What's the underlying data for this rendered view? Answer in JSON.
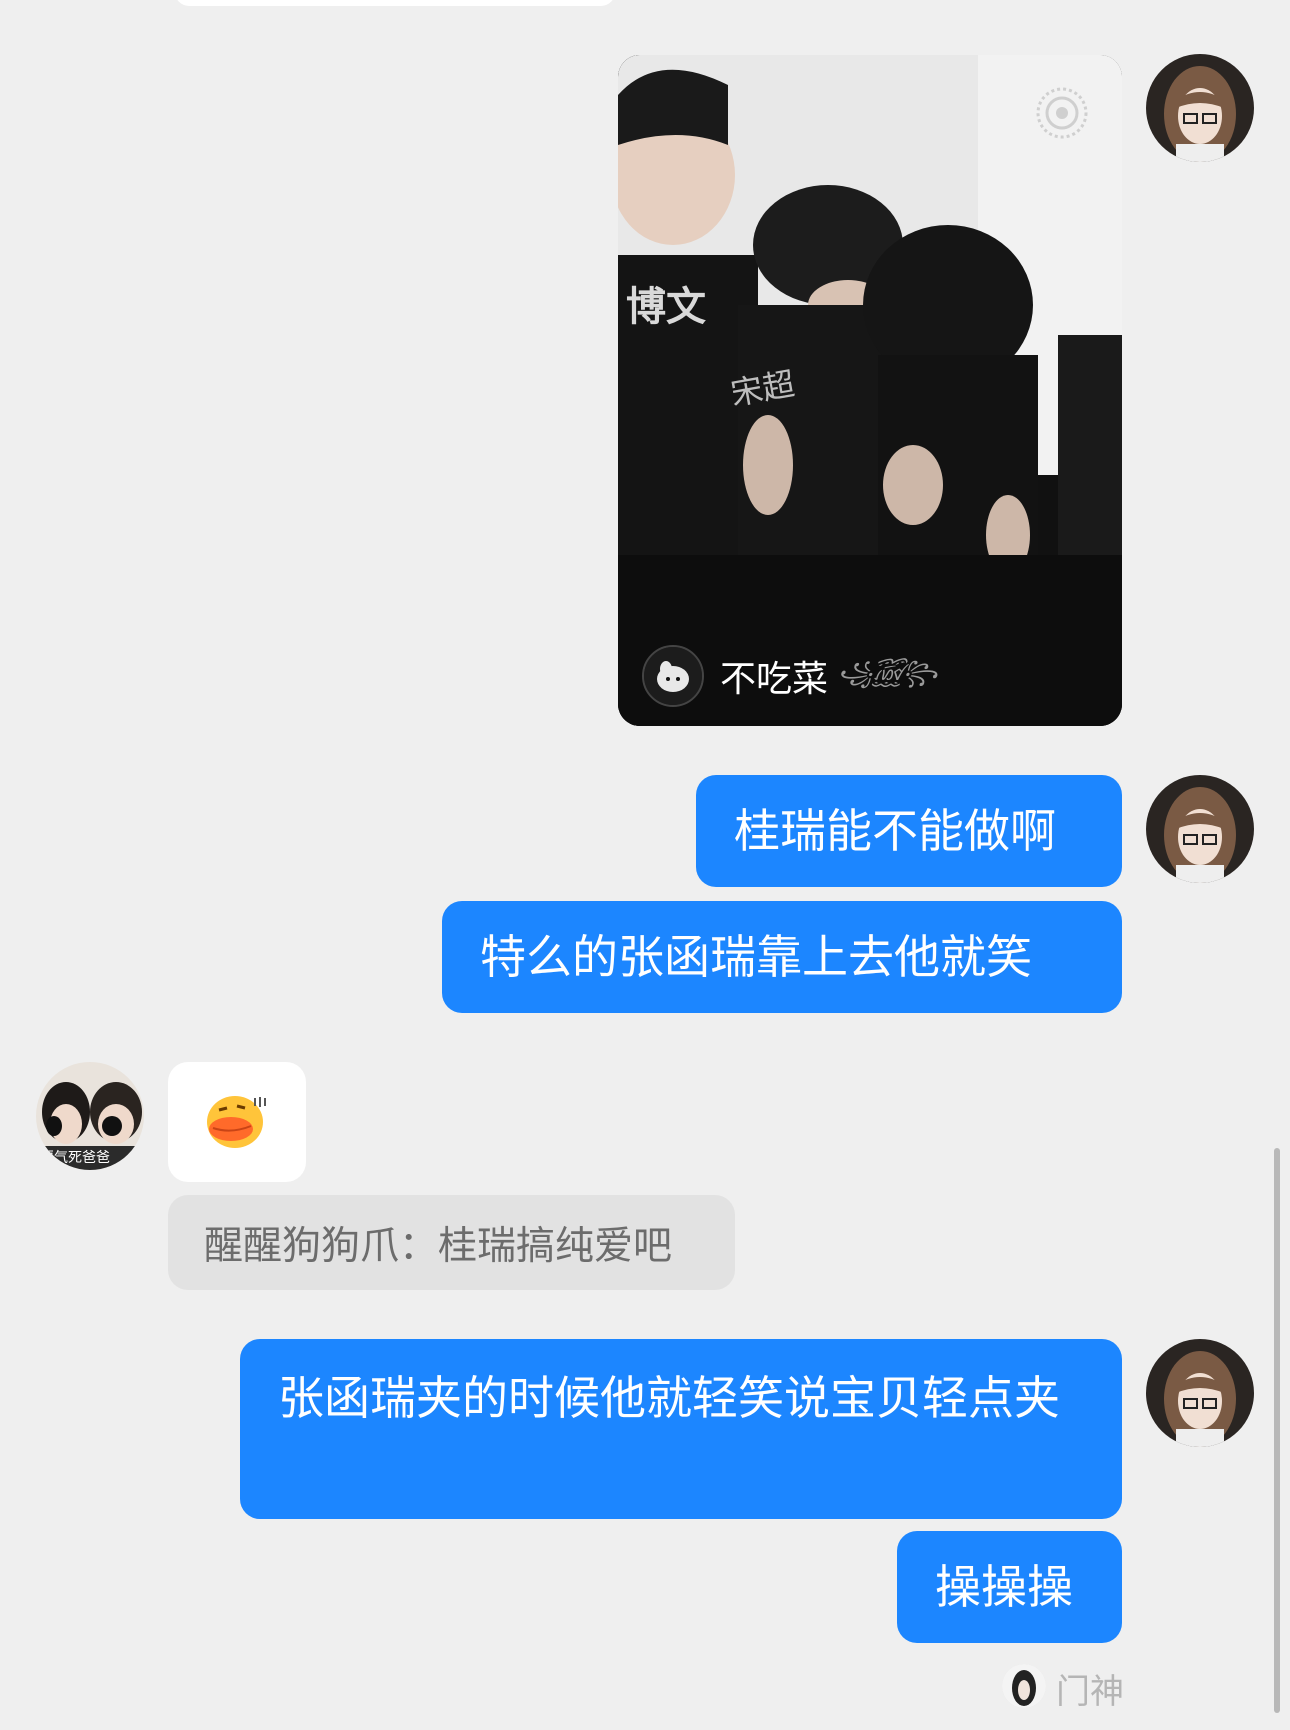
{
  "messages": {
    "video_card": {
      "author_name": "不吃菜",
      "author_decoration": "꧁꫞꧂",
      "shirt_text_1": "博文",
      "shirt_text_2": "宋超"
    },
    "outgoing_1": "桂瑞能不能做啊",
    "outgoing_2": "特么的张函瑞靠上去他就笑",
    "incoming_sticker": "duck-lips-sticker",
    "incoming_avatar_caption": "要气死爸爸",
    "quote": "醒醒狗狗爪：桂瑞搞纯爱吧",
    "outgoing_3": "张函瑞夹的时候他就轻笑说宝贝轻点夹",
    "outgoing_4": "操操操"
  },
  "footer": {
    "text": "门神"
  },
  "colors": {
    "background": "#efefef",
    "outgoing_bubble": "#1c86ff",
    "incoming_bubble": "#ffffff",
    "quote_bubble": "#e2e2e2"
  }
}
